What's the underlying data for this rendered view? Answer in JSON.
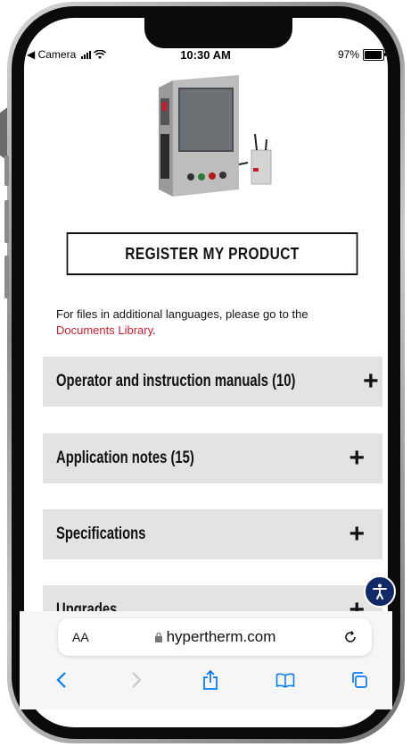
{
  "status_bar": {
    "back_app": "◀ Camera",
    "time": "10:30 AM",
    "battery": "97%"
  },
  "page": {
    "register_button": "REGISTER MY PRODUCT",
    "note_text": "For files in additional languages, please go to the",
    "note_link": "Documents Library",
    "note_end": ".",
    "sections": [
      {
        "label": "Operator and instruction manuals (10)",
        "toggle": "+"
      },
      {
        "label": "Application notes (15)",
        "toggle": "+"
      },
      {
        "label": "Specifications",
        "toggle": "+"
      },
      {
        "label": "Upgrades",
        "toggle": "+"
      }
    ]
  },
  "browser": {
    "text_size": "AA",
    "url": "hypertherm.com"
  },
  "icons": {
    "accessibility": "accessibility-icon",
    "back": "chevron-left-icon",
    "forward": "chevron-right-icon",
    "share": "share-icon",
    "bookmarks": "book-icon",
    "tabs": "tabs-icon"
  },
  "colors": {
    "link": "#c41e2e",
    "accordion_bg": "#e3e3e3",
    "accessibility_bg": "#0f2a66",
    "ios_blue": "#0a7aff"
  }
}
